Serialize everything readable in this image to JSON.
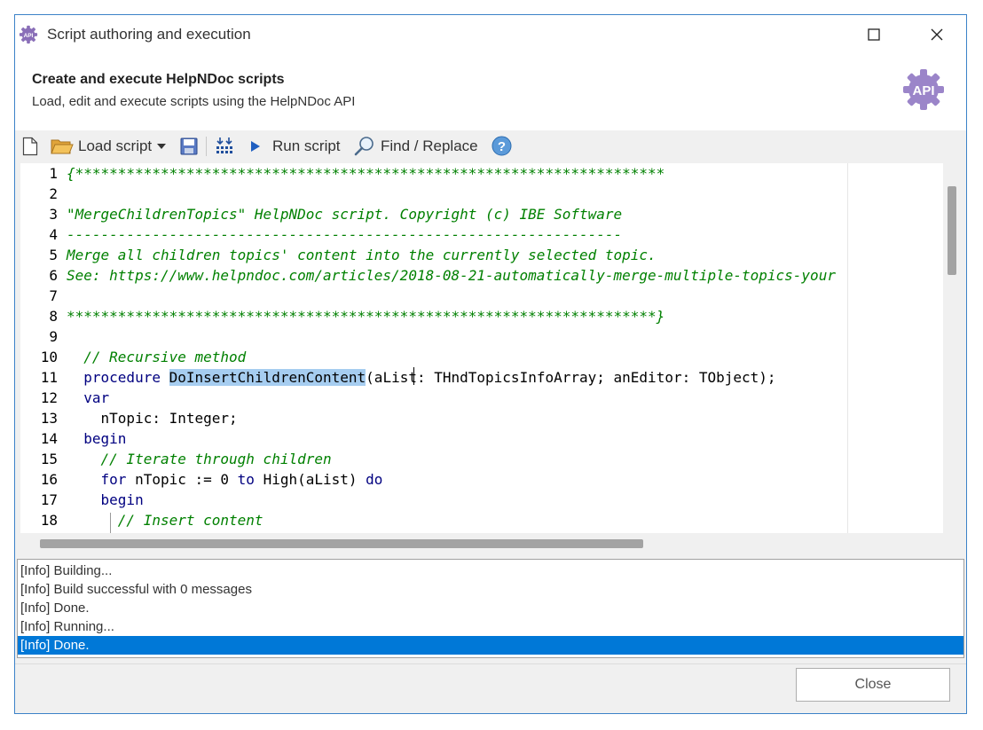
{
  "window": {
    "title": "Script authoring and execution",
    "app_icon": "api-gear-icon",
    "buttons": [
      "maximize-icon",
      "close-icon"
    ]
  },
  "header": {
    "title": "Create and execute HelpNDoc scripts",
    "subtitle": "Load, edit and execute scripts using the HelpNDoc API",
    "icon_label": "API",
    "icon": "api-gear-icon"
  },
  "toolbar": {
    "new_icon": "new-file-icon",
    "load_label": "Load script",
    "load_icon": "folder-icon",
    "save_icon": "save-icon",
    "build_icon": "build-icon",
    "run_label": "Run script",
    "run_icon": "play-icon",
    "find_label": "Find / Replace",
    "find_icon": "magnifier-icon",
    "help_icon": "help-icon",
    "help_glyph": "?"
  },
  "editor": {
    "lines": [
      {
        "number": "1",
        "parts": [
          {
            "t": "{*********************************************************************",
            "c": "cmt"
          }
        ]
      },
      {
        "number": "2",
        "parts": []
      },
      {
        "number": "3",
        "parts": [
          {
            "t": "\"MergeChildrenTopics\" HelpNDoc script. Copyright (c) IBE Software",
            "c": "cmt"
          }
        ]
      },
      {
        "number": "4",
        "parts": [
          {
            "t": "-----------------------------------------------------------------",
            "c": "cmt"
          }
        ]
      },
      {
        "number": "5",
        "parts": [
          {
            "t": "Merge all children topics' content into the currently selected topic.",
            "c": "cmt"
          }
        ]
      },
      {
        "number": "6",
        "parts": [
          {
            "t": "See: https://www.helpndoc.com/articles/2018-08-21-automatically-merge-multiple-topics-your",
            "c": "cmt"
          }
        ]
      },
      {
        "number": "7",
        "parts": []
      },
      {
        "number": "8",
        "parts": [
          {
            "t": "*********************************************************************}",
            "c": "cmt"
          }
        ]
      },
      {
        "number": "9",
        "parts": []
      },
      {
        "number": "10",
        "parts": [
          {
            "t": "  "
          },
          {
            "t": "// Recursive method",
            "c": "cmt"
          }
        ]
      },
      {
        "number": "11",
        "parts": [
          {
            "t": "  "
          },
          {
            "t": "procedure",
            "c": "kw"
          },
          {
            "t": " "
          },
          {
            "t": "DoInsertChildrenContent",
            "c": "sel"
          },
          {
            "t": "(aList: THndTopicsInfoArray; anEditor: TObject);"
          }
        ]
      },
      {
        "number": "12",
        "parts": [
          {
            "t": "  "
          },
          {
            "t": "var",
            "c": "kw"
          }
        ]
      },
      {
        "number": "13",
        "parts": [
          {
            "t": "    nTopic: Integer;"
          }
        ]
      },
      {
        "number": "14",
        "parts": [
          {
            "t": "  "
          },
          {
            "t": "begin",
            "c": "kw"
          }
        ]
      },
      {
        "number": "15",
        "parts": [
          {
            "t": "    "
          },
          {
            "t": "// Iterate through children",
            "c": "cmt"
          }
        ]
      },
      {
        "number": "16",
        "parts": [
          {
            "t": "    "
          },
          {
            "t": "for",
            "c": "kw"
          },
          {
            "t": " nTopic := 0 "
          },
          {
            "t": "to",
            "c": "kw"
          },
          {
            "t": " High(aList) "
          },
          {
            "t": "do",
            "c": "kw"
          }
        ]
      },
      {
        "number": "17",
        "parts": [
          {
            "t": "    "
          },
          {
            "t": "begin",
            "c": "kw"
          }
        ]
      },
      {
        "number": "18",
        "parts": [
          {
            "t": "      "
          },
          {
            "t": "// Insert content",
            "c": "cmt"
          }
        ]
      }
    ]
  },
  "log": {
    "items": [
      {
        "text": "[Info] Building...",
        "selected": false
      },
      {
        "text": "[Info] Build successful with 0 messages",
        "selected": false
      },
      {
        "text": "[Info] Done.",
        "selected": false
      },
      {
        "text": "[Info] Running...",
        "selected": false
      },
      {
        "text": "[Info] Done.",
        "selected": true
      }
    ]
  },
  "footer": {
    "close_label": "Close"
  },
  "colors": {
    "comment": "#008000",
    "keyword": "#000080",
    "selection": "#a6cdf0",
    "log_selected": "#0078d7",
    "window_border": "#3c82c8"
  }
}
